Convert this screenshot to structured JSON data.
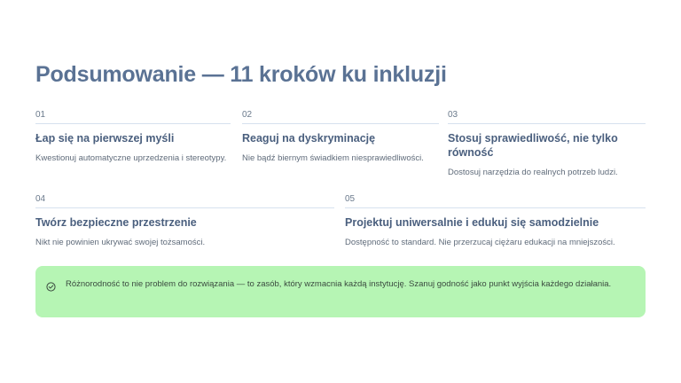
{
  "title": "Podsumowanie — 11 kroków ku inkluzji",
  "steps": [
    {
      "number": "01",
      "heading": "Łap się na pierwszej myśli",
      "description": "Kwestionuj automatyczne uprzedzenia i stereotypy."
    },
    {
      "number": "02",
      "heading": "Reaguj na dyskryminację",
      "description": "Nie bądź biernym świadkiem niesprawiedliwości."
    },
    {
      "number": "03",
      "heading": "Stosuj sprawiedliwość, nie tylko równość",
      "description": "Dostosuj narzędzia do realnych potrzeb ludzi."
    },
    {
      "number": "04",
      "heading": "Twórz bezpieczne przestrzenie",
      "description": "Nikt nie powinien ukrywać swojej tożsamości."
    },
    {
      "number": "05",
      "heading": "Projektuj uniwersalnie i edukuj się samodzielnie",
      "description": "Dostępność to standard. Nie przerzucaj ciężaru edukacji na mniejszości."
    }
  ],
  "banner": {
    "icon": "check-circle-icon",
    "text": "Różnorodność to nie problem do rozwiązania — to zasób, który wzmacnia każdą instytucję. Szanuj godność jako punkt wyjścia każdego działania."
  },
  "colors": {
    "accent": "#5a7294",
    "banner_bg": "#b6f5b4"
  }
}
